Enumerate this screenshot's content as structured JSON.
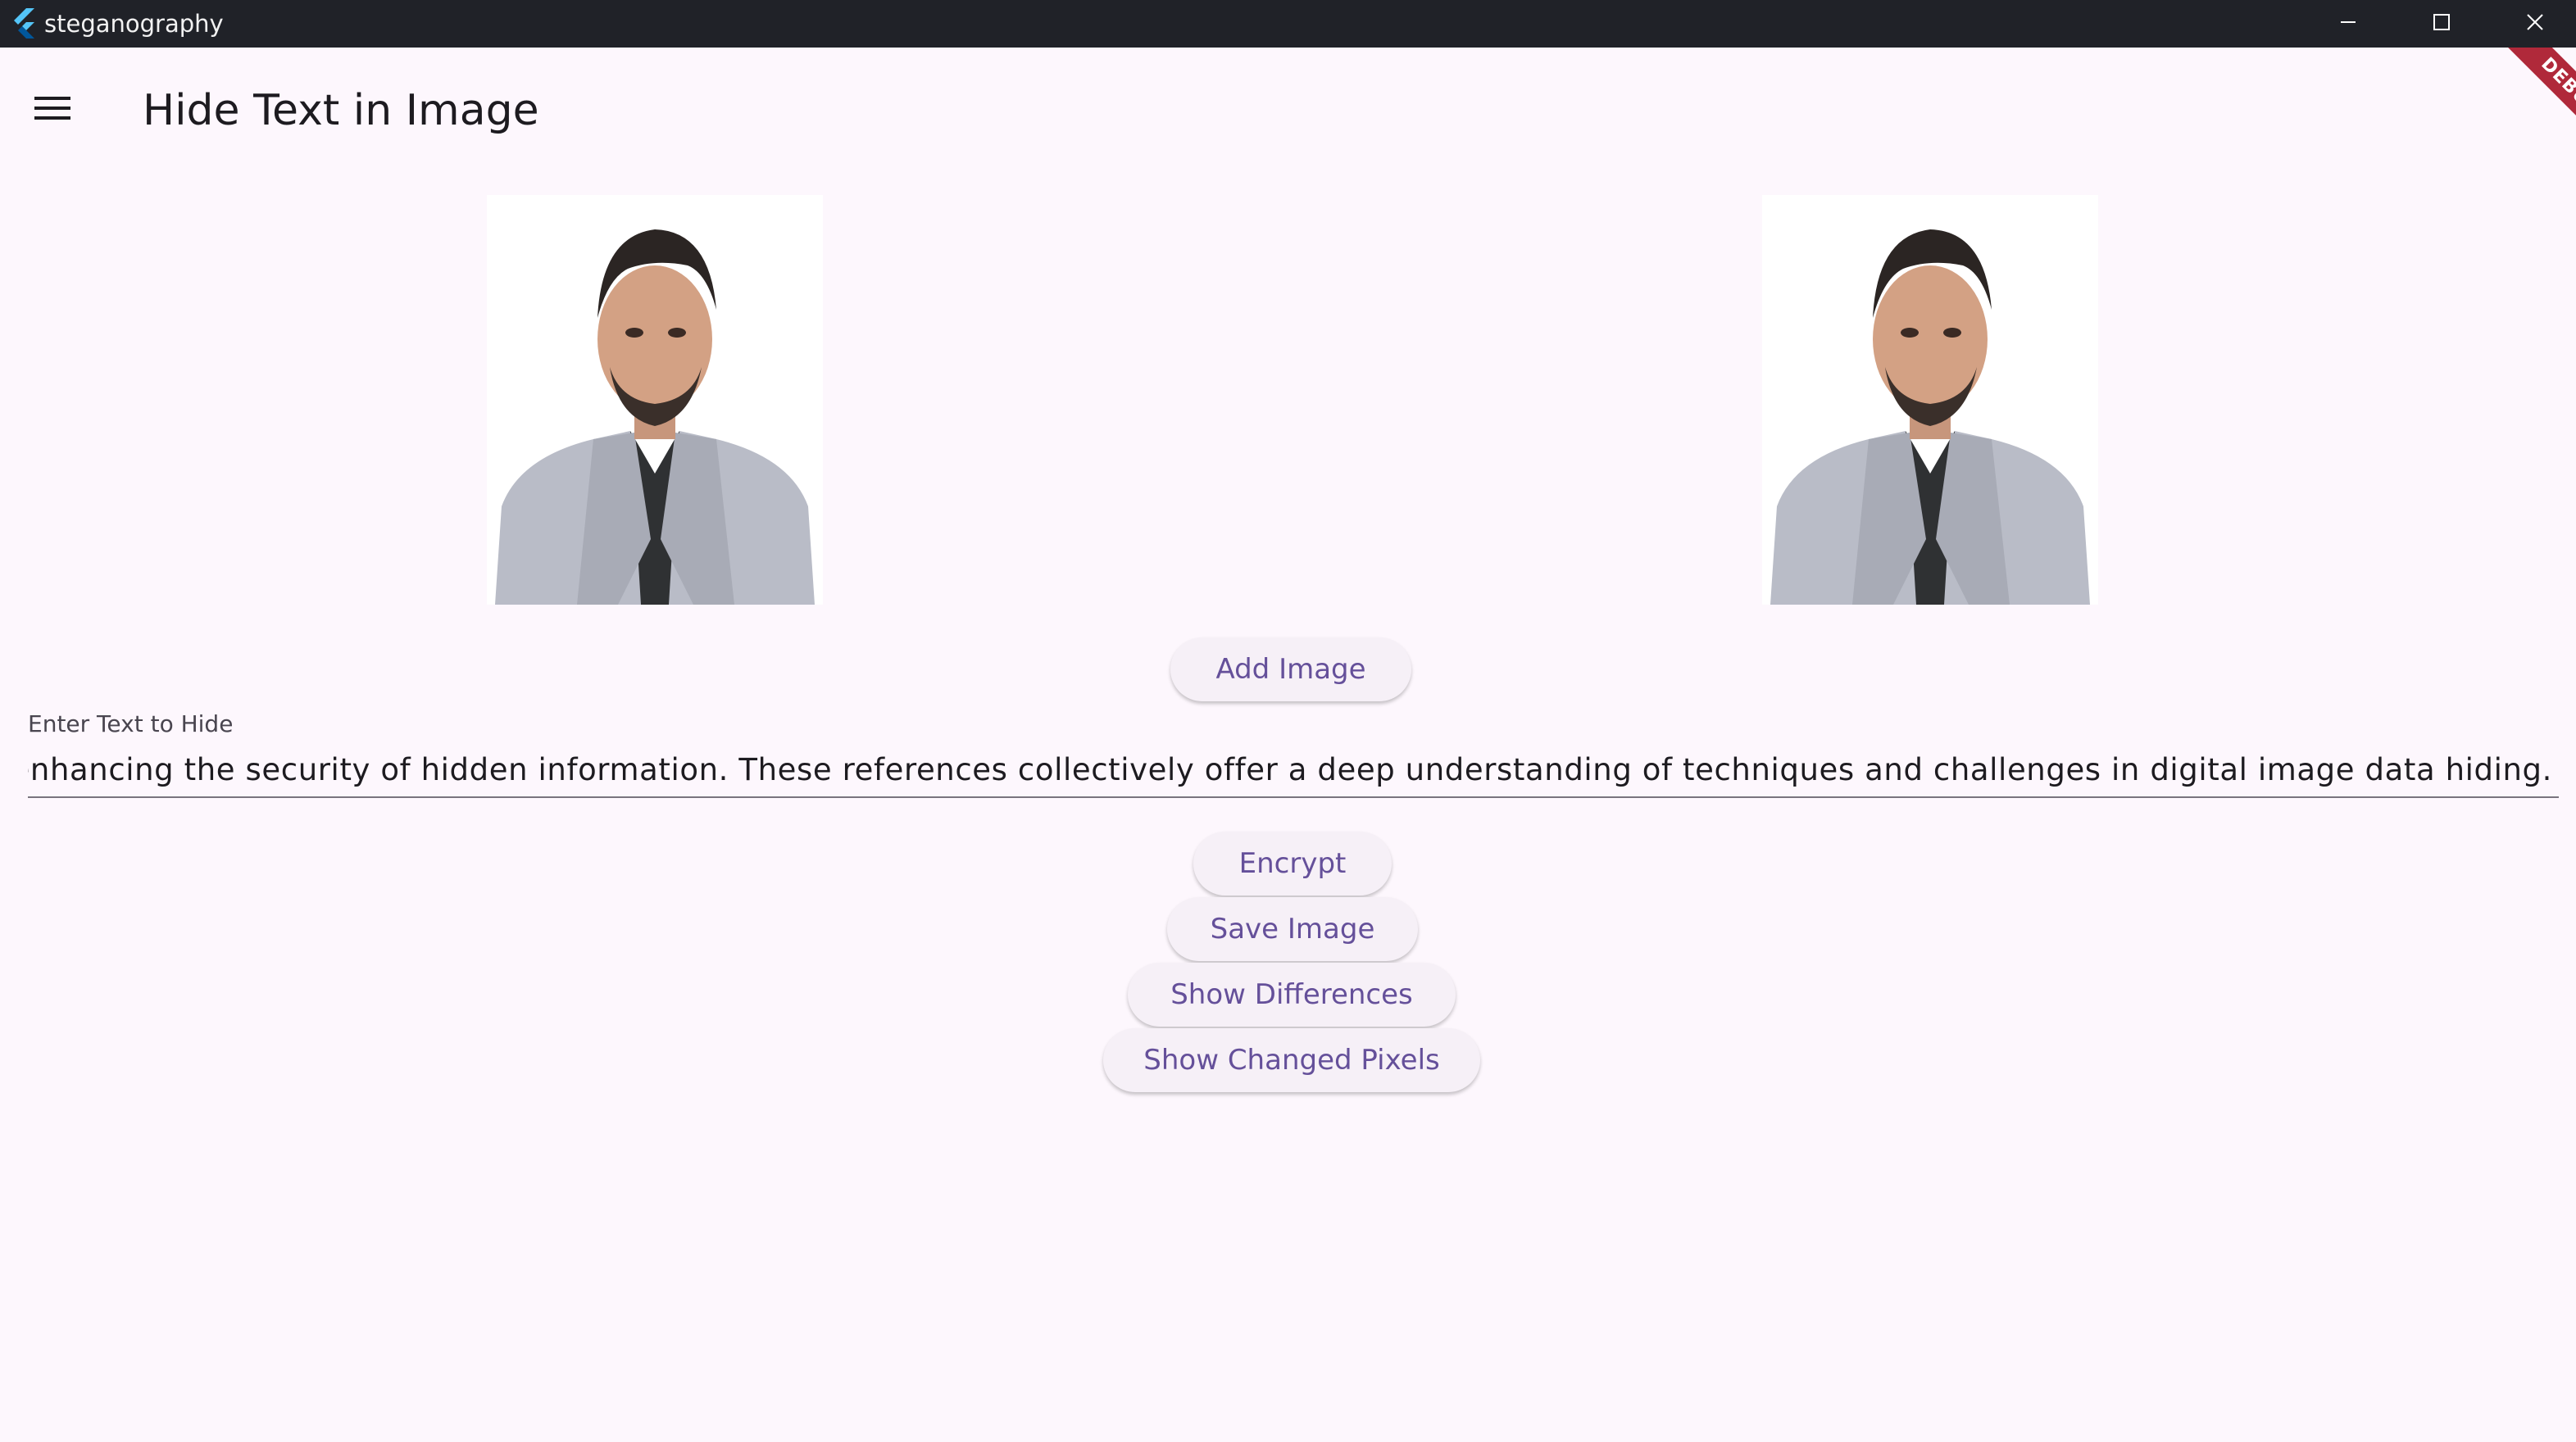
{
  "window": {
    "title": "steganography"
  },
  "appbar": {
    "title": "Hide Text in Image",
    "menu_icon": "hamburger-menu-icon"
  },
  "debug_banner": {
    "label": "DEBUG",
    "color": "#b0293a"
  },
  "images": {
    "left_icon": "portrait-photo",
    "right_icon": "portrait-photo"
  },
  "buttons": {
    "add_image": "Add Image",
    "encrypt": "Encrypt",
    "save_image": "Save Image",
    "show_differences": "Show Differences",
    "show_changed_pixels": "Show Changed Pixels"
  },
  "text_field": {
    "label": "Enter Text to Hide",
    "value": "es, enhancing the security of hidden information. These references collectively offer a deep understanding of techniques and challenges in digital image data hiding."
  },
  "colors": {
    "accent": "#65509a",
    "background": "#fdf7fd",
    "titlebar": "#202228"
  }
}
